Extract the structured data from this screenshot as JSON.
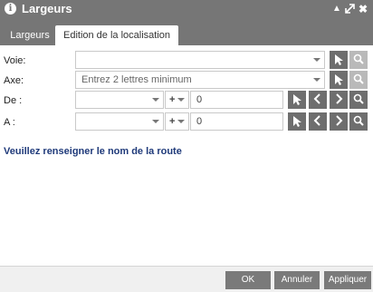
{
  "window": {
    "title": "Largeurs",
    "controls": [
      "collapse-icon",
      "expand-icon",
      "close-icon"
    ]
  },
  "tabs": [
    {
      "label": "Largeurs",
      "active": false
    },
    {
      "label": "Edition de la localisation",
      "active": true
    }
  ],
  "form": {
    "voie": {
      "label": "Voie:",
      "value": ""
    },
    "axe": {
      "label": "Axe:",
      "placeholder": "Entrez 2 lettres minimum"
    },
    "de": {
      "label": "De :",
      "select_value": "",
      "sign": "+",
      "number": "0"
    },
    "a": {
      "label": "A :",
      "select_value": "",
      "sign": "+",
      "number": "0"
    }
  },
  "message": "Veuillez renseigner le nom de la route",
  "footer": {
    "ok": "OK",
    "annuler": "Annuler",
    "appliquer": "Appliquer"
  },
  "colors": {
    "titlebar": "#767676",
    "button_dark": "#6e6e6e",
    "button_light": "#b9b9b9",
    "message": "#1f3a7a"
  }
}
